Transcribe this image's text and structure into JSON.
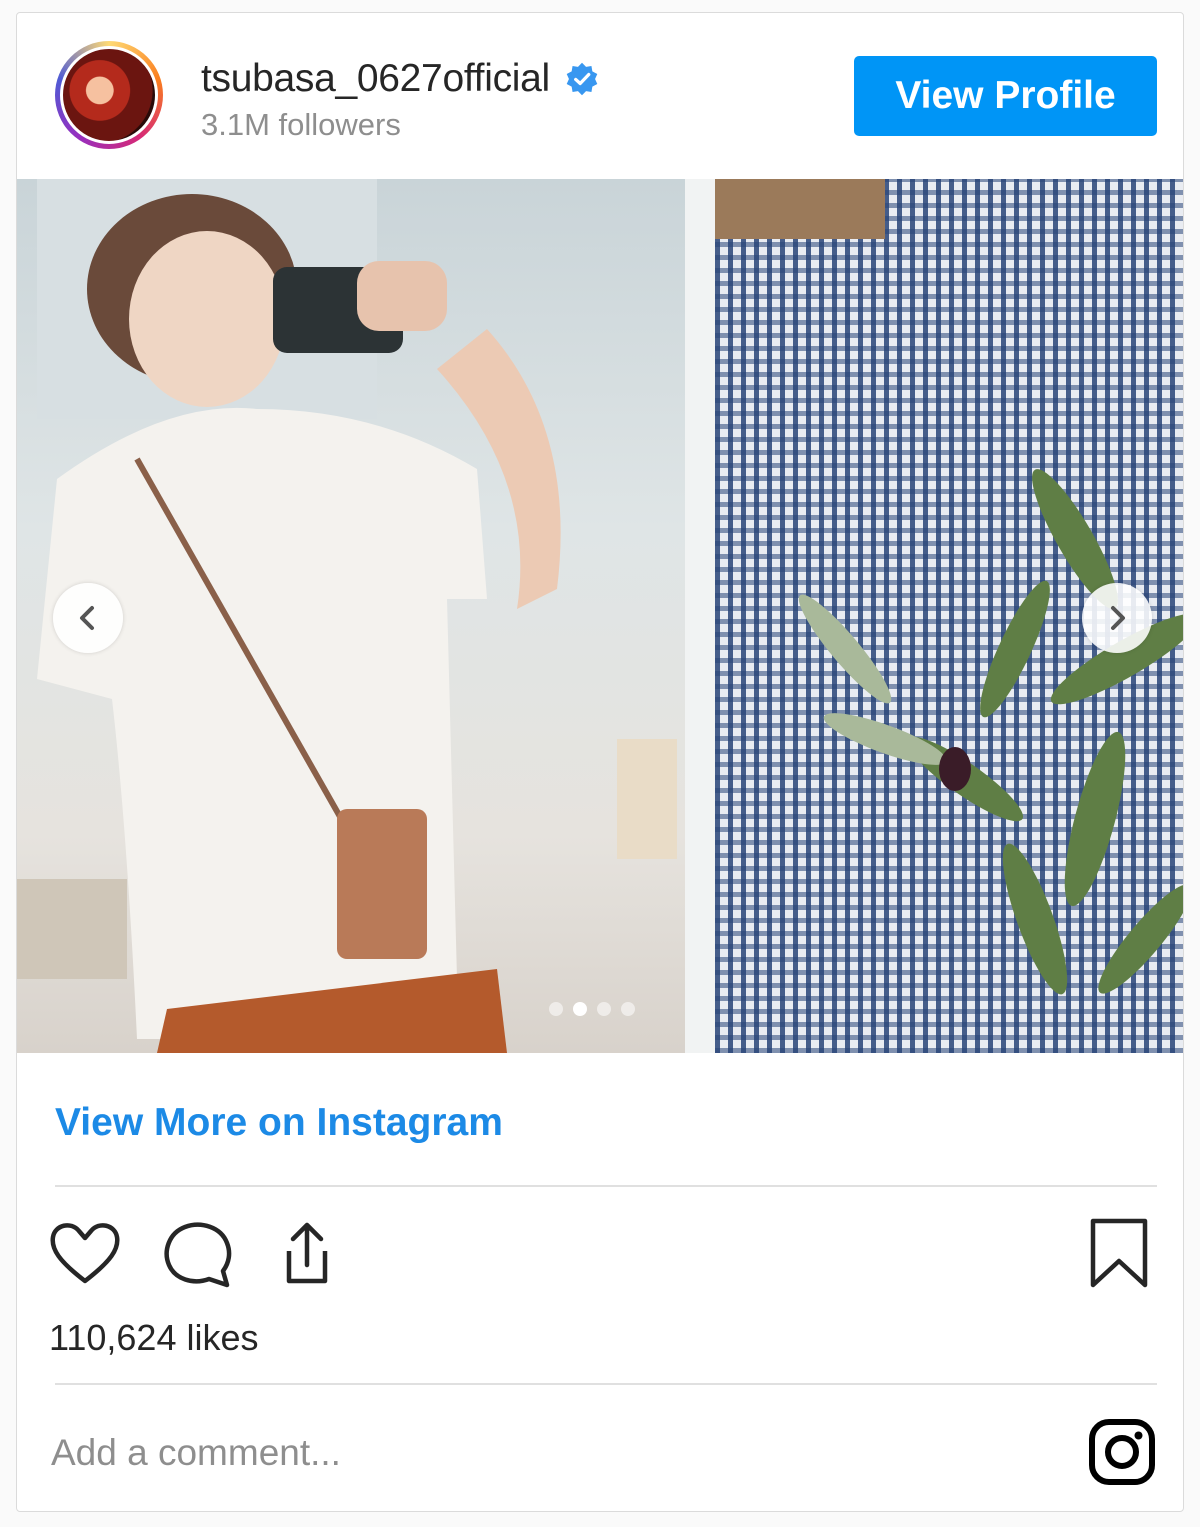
{
  "header": {
    "username": "tsubasa_0627official",
    "followers": "3.1M followers",
    "view_profile_label": "View Profile",
    "verified_icon": "verified-badge-icon"
  },
  "carousel": {
    "slide_count": 4,
    "active_slide": 2,
    "prev_icon": "chevron-left-icon",
    "next_icon": "chevron-right-icon"
  },
  "links": {
    "view_more_label": "View More on Instagram"
  },
  "actions": {
    "icons": [
      "heart-icon",
      "comment-icon",
      "share-icon",
      "bookmark-icon"
    ]
  },
  "likes": "110,624 likes",
  "comment": {
    "placeholder": "Add a comment..."
  },
  "colors": {
    "accent": "#0095f6",
    "link": "#1c8ae6",
    "text": "#262626",
    "muted": "#8e8e8e"
  }
}
